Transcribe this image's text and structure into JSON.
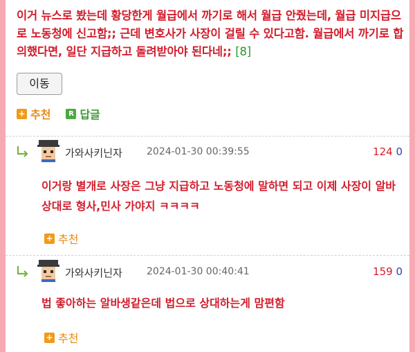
{
  "post": {
    "text": "이거 뉴스로 봤는데 황당한게 월급에서 까기로 해서 월급 안줬는데, 월급 미지급으로 노동청에 신고함;; 근데 변호사가 사장이 걸릴 수 있다고함. 월급에서 까기로 합의했다면, 일단 지급하고 돌려받아야 된다네;;",
    "comment_count": "[8]",
    "move_button": "이동",
    "recommend_label": "추천",
    "reply_label": "답글"
  },
  "icons": {
    "plus": "plus-icon",
    "reply_r": "R",
    "reply_arrow": "reply-arrow-icon"
  },
  "comments": [
    {
      "nickname": "가와사키닌자",
      "time": "2024-01-30 00:39:55",
      "upvotes": "124",
      "downvotes": "0",
      "text": "이거랑 별개로 사장은 그냥 지급하고 노동청에 말하면 되고 이제 사장이 알바상대로 형사,민사 가야지 ㅋㅋㅋㅋ",
      "recommend_label": "추천"
    },
    {
      "nickname": "가와사키닌자",
      "time": "2024-01-30 00:40:41",
      "upvotes": "159",
      "downvotes": "0",
      "text": "법 좋아하는 알바생같은데 법으로 상대하는게 맘편함",
      "recommend_label": "추천"
    }
  ],
  "colors": {
    "accent_red": "#d21d2c",
    "edge_pink": "#f6a9b5",
    "recommend_orange": "#f19a19",
    "reply_green": "#4fa845"
  }
}
